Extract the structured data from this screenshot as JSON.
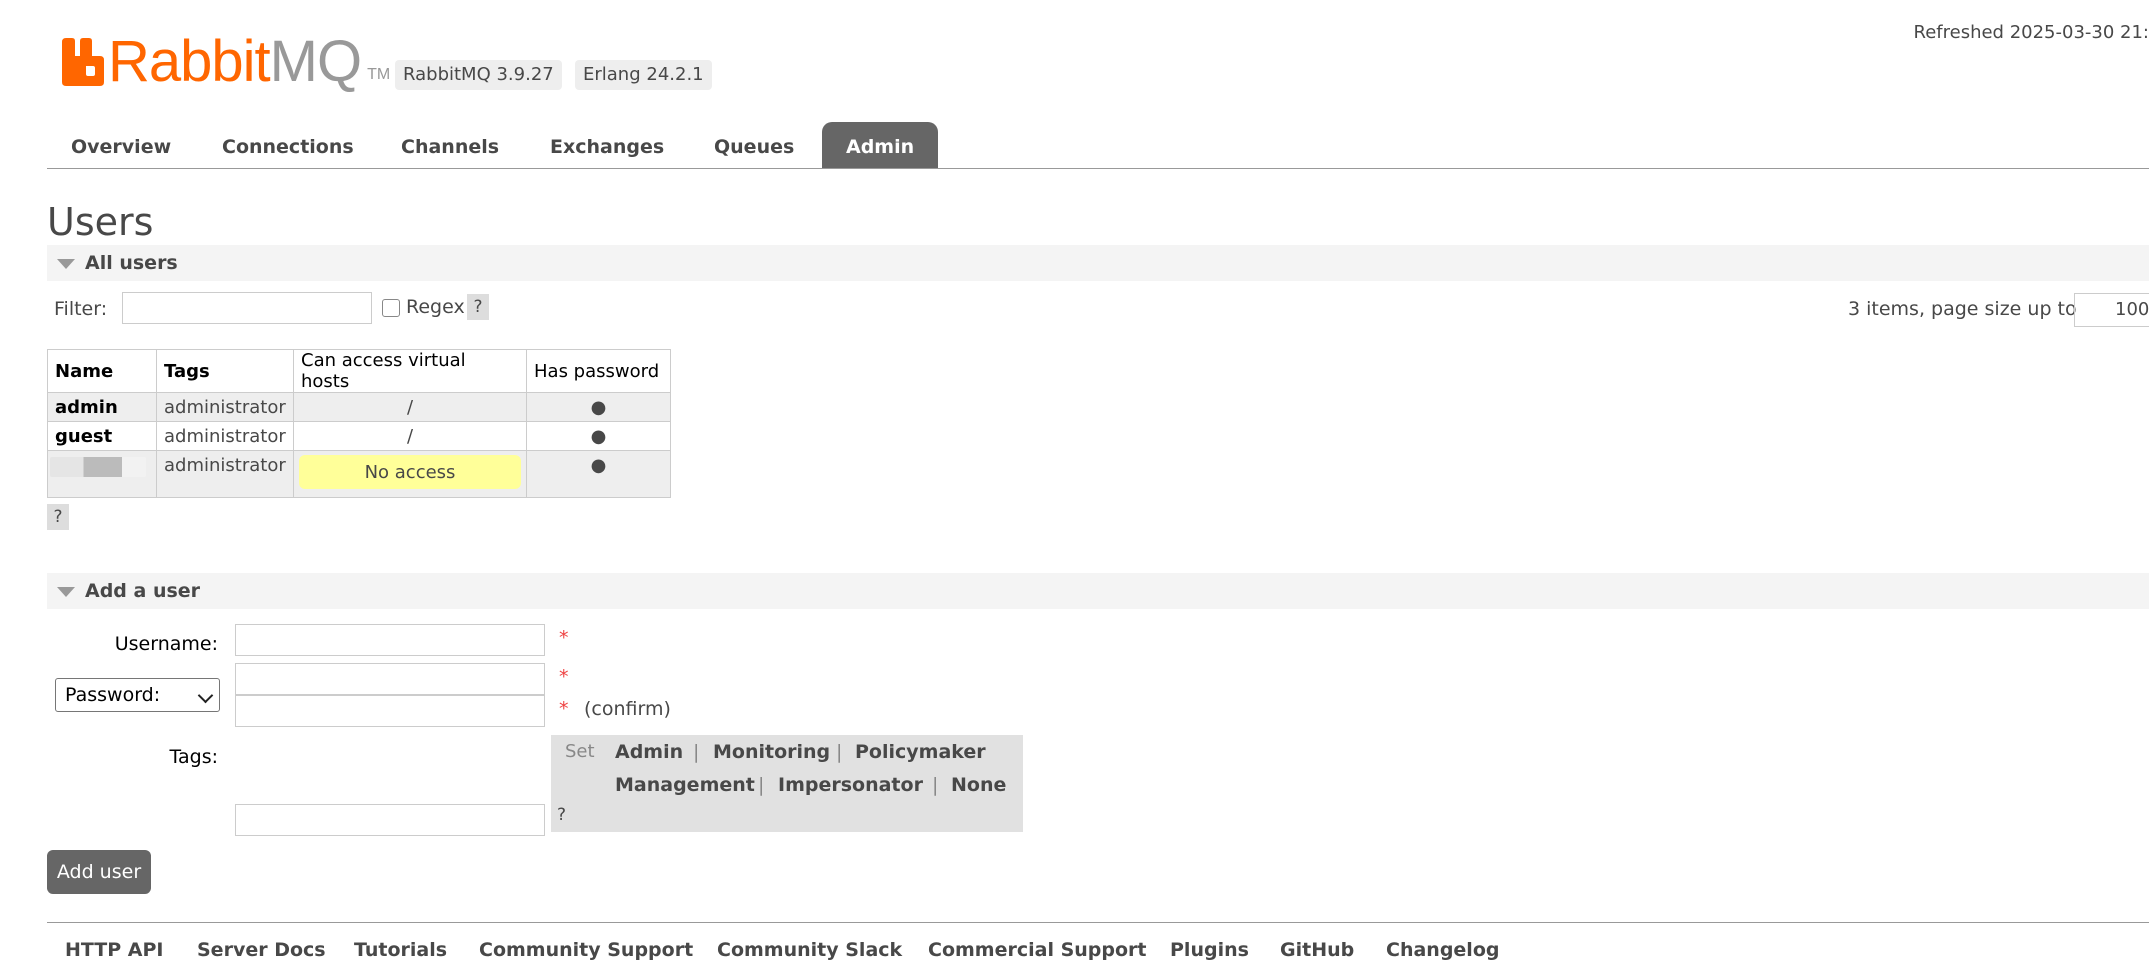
{
  "header": {
    "logo_rabbit": "Rabbit",
    "logo_mq": "MQ",
    "logo_tm": "TM",
    "rabbitmq_version": "RabbitMQ 3.9.27",
    "erlang_version": "Erlang 24.2.1",
    "refreshed": "Refreshed 2025-03-30 21:"
  },
  "tabs": [
    {
      "label": "Overview"
    },
    {
      "label": "Connections"
    },
    {
      "label": "Channels"
    },
    {
      "label": "Exchanges"
    },
    {
      "label": "Queues"
    },
    {
      "label": "Admin",
      "active": true
    }
  ],
  "page_title": "Users",
  "all_users": {
    "section_label": "All users",
    "filter_label": "Filter:",
    "filter_value": "",
    "regex_label": "Regex",
    "regex_checked": false,
    "help": "?",
    "items_info": "3 items, page size up to",
    "page_size": "100",
    "columns": [
      "Name",
      "Tags",
      "Can access virtual hosts",
      "Has password"
    ],
    "rows": [
      {
        "name": "admin",
        "tags": "administrator",
        "vhosts": "/",
        "has_password": "●"
      },
      {
        "name": "guest",
        "tags": "administrator",
        "vhosts": "/",
        "has_password": "●"
      },
      {
        "name": "",
        "tags": "administrator",
        "vhosts": "No access",
        "has_password": "●"
      }
    ],
    "table_help": "?"
  },
  "add_user": {
    "section_label": "Add a user",
    "username_label": "Username:",
    "password_select": "Password:",
    "confirm_label": "(confirm)",
    "required_mark": "*",
    "tags_label": "Tags:",
    "tags_set_label": "Set",
    "tag_options": [
      "Admin",
      "Monitoring",
      "Policymaker",
      "Management",
      "Impersonator",
      "None"
    ],
    "separator": "|",
    "tags_help": "?",
    "submit_label": "Add user"
  },
  "footer_links": [
    "HTTP API",
    "Server Docs",
    "Tutorials",
    "Community Support",
    "Community Slack",
    "Commercial Support",
    "Plugins",
    "GitHub",
    "Changelog"
  ],
  "colors": {
    "brand_orange": "#ff6600",
    "tab_active": "#666666",
    "no_access_bg": "#ffff99"
  }
}
